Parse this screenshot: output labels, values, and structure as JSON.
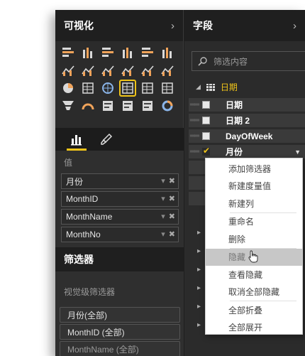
{
  "visualizations": {
    "title": "可视化",
    "chevron": "›",
    "viz_icons": [
      "stacked-bar-icon",
      "stacked-column-icon",
      "clustered-bar-icon",
      "clustered-column-icon",
      "100-bar-icon",
      "100-column-icon",
      "line-chart-icon",
      "area-chart-icon",
      "stacked-area-icon",
      "line-column-icon",
      "ribbon-chart-icon",
      "waterfall-icon",
      "pie-chart-icon",
      "donut-grid-icon",
      "globe-map-icon",
      "table-icon",
      "matrix-icon",
      "filled-map-icon",
      "funnel-icon",
      "gauge-icon",
      "card-icon",
      "multirow-card-icon",
      "kpi-icon",
      "donut-icon"
    ],
    "selected_icon_index": 15,
    "tabs": [
      "fields-tab-icon",
      "format-tab-icon"
    ],
    "values_label": "值",
    "values": [
      "月份",
      "MonthID",
      "MonthName",
      "MonthNo"
    ],
    "well_dropdown": "▾",
    "well_remove": "✖"
  },
  "filters": {
    "title": "筛选器",
    "visual_level_label": "视觉级筛选器",
    "items": [
      "月份(全部)",
      "MonthID (全部)",
      "MonthName (全部)"
    ]
  },
  "fields": {
    "title": "字段",
    "chevron": "›",
    "search_placeholder": "筛选内容",
    "table_name": "日期",
    "rows": [
      {
        "label": "日期",
        "checked": false
      },
      {
        "label": "日期 2",
        "checked": false
      },
      {
        "label": "DayOfWeek",
        "checked": false
      },
      {
        "label": "月份",
        "checked": true
      }
    ]
  },
  "context_menu": {
    "items": [
      "添加筛选器",
      "新建度量值",
      "新建列",
      "重命名",
      "删除",
      "隐藏",
      "查看隐藏",
      "取消全部隐藏",
      "全部折叠",
      "全部展开"
    ],
    "hover_index": 5
  },
  "colors": {
    "accent": "#f0c419",
    "panel": "#2b2b2b",
    "header": "#1f1f1f"
  }
}
